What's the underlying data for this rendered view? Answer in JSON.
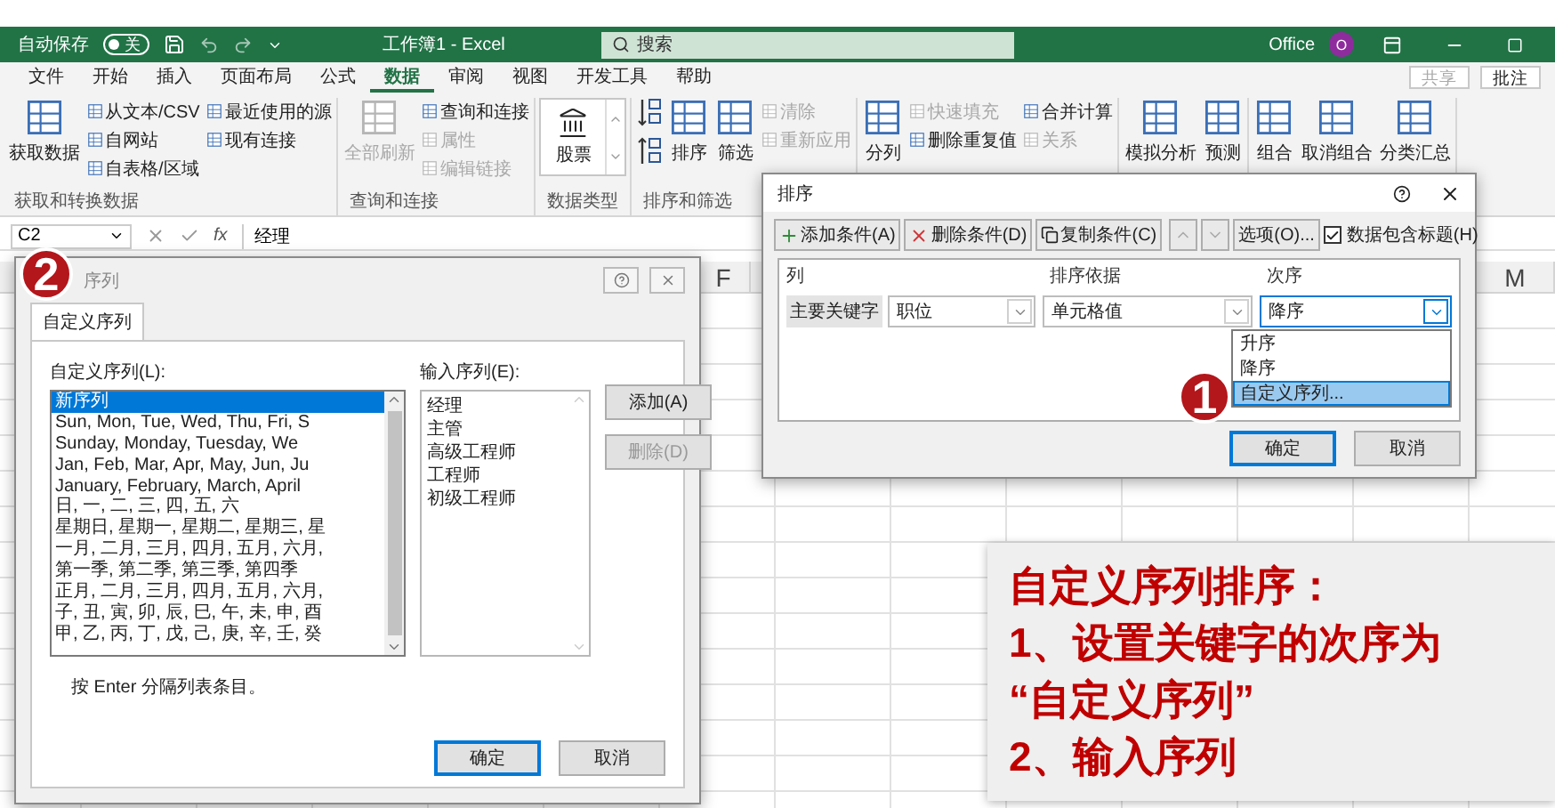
{
  "title_bar": {
    "autosave_label": "自动保存",
    "autosave": {
      "on": false,
      "label": "关"
    },
    "title": "工作簿1 - Excel",
    "search": {
      "placeholder": "搜索"
    },
    "account": "Office",
    "avatar": "O"
  },
  "menu_tabs": [
    {
      "label": "文件",
      "selected": false
    },
    {
      "label": "开始",
      "selected": false
    },
    {
      "label": "插入",
      "selected": false
    },
    {
      "label": "页面布局",
      "selected": false
    },
    {
      "label": "公式",
      "selected": false
    },
    {
      "label": "数据",
      "selected": true
    },
    {
      "label": "审阅",
      "selected": false
    },
    {
      "label": "视图",
      "selected": false
    },
    {
      "label": "开发工具",
      "selected": false
    },
    {
      "label": "帮助",
      "selected": false
    }
  ],
  "share_button": {
    "label": "共享",
    "disabled": true
  },
  "comments_button": {
    "label": "批注"
  },
  "ribbon_groups": [
    {
      "label": "获取和转换数据",
      "items": [
        {
          "kind": "large",
          "label": "获取数据",
          "disabled": false
        },
        {
          "kind": "column",
          "items": [
            {
              "label": "从文本/CSV",
              "disabled": false
            },
            {
              "label": "自网站",
              "disabled": false
            },
            {
              "label": "自表格/区域",
              "disabled": false
            }
          ]
        },
        {
          "kind": "column",
          "items": [
            {
              "label": "最近使用的源",
              "disabled": false
            },
            {
              "label": "现有连接",
              "disabled": false
            }
          ]
        }
      ]
    },
    {
      "label": "查询和连接",
      "items": [
        {
          "kind": "large",
          "label": "全部刷新",
          "disabled": true
        },
        {
          "kind": "column",
          "items": [
            {
              "label": "查询和连接",
              "disabled": false
            },
            {
              "label": "属性",
              "disabled": true
            },
            {
              "label": "编辑链接",
              "disabled": true
            }
          ]
        }
      ]
    },
    {
      "label": "数据类型",
      "items": [
        {
          "kind": "gallery",
          "label": "股票"
        }
      ]
    },
    {
      "label": "排序和筛选",
      "items": [
        {
          "kind": "sort_buttons"
        },
        {
          "kind": "large",
          "label": "排序",
          "disabled": false
        },
        {
          "kind": "large",
          "label": "筛选",
          "disabled": false
        },
        {
          "kind": "column",
          "items": [
            {
              "label": "清除",
              "disabled": true
            },
            {
              "label": "重新应用",
              "disabled": true
            }
          ]
        }
      ]
    },
    {
      "items": [
        {
          "kind": "large",
          "label": "分列",
          "disabled": false
        },
        {
          "kind": "column",
          "items": [
            {
              "label": "快速填充",
              "disabled": true
            },
            {
              "label": "删除重复值",
              "disabled": false
            }
          ]
        },
        {
          "kind": "column",
          "items": [
            {
              "label": "合并计算",
              "disabled": false
            },
            {
              "label": "关系",
              "disabled": true
            }
          ]
        }
      ]
    },
    {
      "items": [
        {
          "kind": "large",
          "label": "模拟分析",
          "disabled": false
        },
        {
          "kind": "large",
          "label": "预测",
          "disabled": false
        }
      ]
    },
    {
      "items": [
        {
          "kind": "large",
          "label": "组合",
          "disabled": false
        },
        {
          "kind": "large",
          "label": "取消组合",
          "disabled": false
        },
        {
          "kind": "large",
          "label": "分类汇总",
          "disabled": false
        }
      ]
    }
  ],
  "formula_bar": {
    "name_box": "C2",
    "fx": "fx",
    "value": "经理"
  },
  "sheet": {
    "columns": [
      {
        "label": "F"
      },
      {
        "label": "M"
      }
    ]
  },
  "custom_list_dialog": {
    "badge": "2",
    "title": "序列",
    "tabs": [
      {
        "label": "自定义序列",
        "selected": true
      }
    ],
    "lists_label": "自定义序列(L):",
    "lists": [
      {
        "label": "新序列",
        "selected": true
      },
      {
        "label": "Sun, Mon, Tue, Wed, Thu, Fri, S",
        "selected": false
      },
      {
        "label": "Sunday, Monday, Tuesday, We",
        "selected": false
      },
      {
        "label": "Jan, Feb, Mar, Apr, May, Jun, Ju",
        "selected": false
      },
      {
        "label": "January, February, March, April",
        "selected": false
      },
      {
        "label": "日, 一, 二, 三, 四, 五, 六",
        "selected": false
      },
      {
        "label": "星期日, 星期一, 星期二, 星期三, 星",
        "selected": false
      },
      {
        "label": "一月, 二月, 三月, 四月, 五月, 六月,",
        "selected": false
      },
      {
        "label": "第一季, 第二季, 第三季, 第四季",
        "selected": false
      },
      {
        "label": "正月, 二月, 三月, 四月, 五月, 六月,",
        "selected": false
      },
      {
        "label": "子, 丑, 寅, 卯, 辰, 巳, 午, 未, 申, 酉",
        "selected": false
      },
      {
        "label": "甲, 乙, 丙, 丁, 戊, 己, 庚, 辛, 壬, 癸",
        "selected": false
      }
    ],
    "entries_label": "输入序列(E):",
    "entries": [
      "经理",
      "主管",
      "高级工程师",
      "工程师",
      "初级工程师"
    ],
    "add_button": {
      "label": "添加(A)",
      "disabled": false
    },
    "delete_button": {
      "label": "删除(D)",
      "disabled": true
    },
    "hint": "按 Enter 分隔列表条目。",
    "ok_button": "确定",
    "cancel_button": "取消"
  },
  "sort_dialog": {
    "badge": "1",
    "title": "排序",
    "toolbar": [
      {
        "kind": "add",
        "label": "添加条件(A)"
      },
      {
        "kind": "delete",
        "label": "删除条件(D)"
      },
      {
        "kind": "copy",
        "label": "复制条件(C)"
      },
      {
        "kind": "move_up"
      },
      {
        "kind": "move_down"
      },
      {
        "kind": "plain",
        "label": "选项(O)..."
      }
    ],
    "has_headers": {
      "label": "数据包含标题(H)",
      "checked": true
    },
    "columns": [
      "列",
      "排序依据",
      "次序"
    ],
    "rule": {
      "key_label": "主要关键字",
      "column": "职位",
      "sort_on": "单元格值",
      "order": "降序"
    },
    "order_options": [
      {
        "label": "升序",
        "selected": false
      },
      {
        "label": "降序",
        "selected": false
      },
      {
        "label": "自定义序列...",
        "selected": true
      }
    ],
    "ok_button": "确定",
    "cancel_button": "取消"
  },
  "annotation": {
    "lines": [
      "自定义序列排序：",
      "1、设置关键字的次序为",
      "“自定义序列”",
      "2、输入序列"
    ]
  }
}
